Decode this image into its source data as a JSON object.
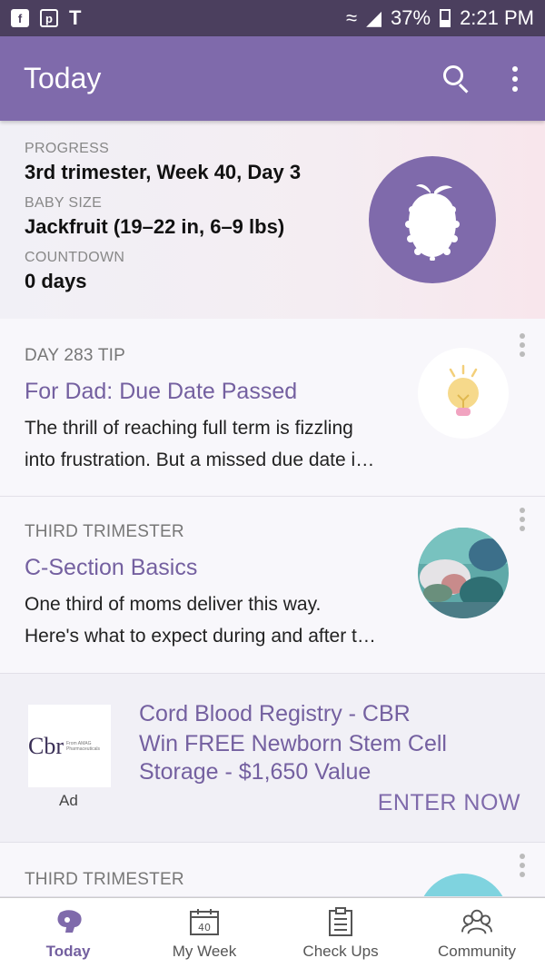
{
  "status_bar": {
    "battery": "37%",
    "time": "2:21 PM",
    "left_icons": [
      "facebook-icon",
      "messenger-icon",
      "tmobile-icon"
    ]
  },
  "app_bar": {
    "title": "Today"
  },
  "progress": {
    "progress_label": "PROGRESS",
    "progress_value": "3rd trimester, Week 40, Day 3",
    "size_label": "BABY SIZE",
    "size_value": "Jackfruit (19–22 in, 6–9 lbs)",
    "countdown_label": "COUNTDOWN",
    "countdown_value": "0 days"
  },
  "cards": [
    {
      "overline": "DAY 283 TIP",
      "title": "For Dad: Due Date Passed",
      "body_line1": "The thrill of reaching full term is fizzling",
      "body_line2": "into frustration. But a missed due date i…"
    },
    {
      "overline": "THIRD TRIMESTER",
      "title": "C-Section Basics",
      "body_line1": "One third of moms deliver this way.",
      "body_line2": "Here's what to expect during and after t…"
    },
    {
      "overline": "THIRD TRIMESTER"
    }
  ],
  "ad": {
    "logo_text": "Cbr",
    "logo_sub": "From AMAG Pharmaceuticals",
    "tag": "Ad",
    "title": "Cord Blood Registry - CBR",
    "description": "Win FREE Newborn Stem Cell Storage - $1,650 Value",
    "cta": "ENTER NOW"
  },
  "bottom_nav": {
    "items": [
      {
        "label": "Today",
        "icon": "baby-icon",
        "active": true
      },
      {
        "label": "My Week",
        "icon": "calendar-icon",
        "calendar_number": "40"
      },
      {
        "label": "Check Ups",
        "icon": "clipboard-icon"
      },
      {
        "label": "Community",
        "icon": "community-icon"
      }
    ]
  },
  "colors": {
    "primary": "#7f6aab",
    "status_bar": "#4b3f5e",
    "title_text": "#7460a0"
  }
}
